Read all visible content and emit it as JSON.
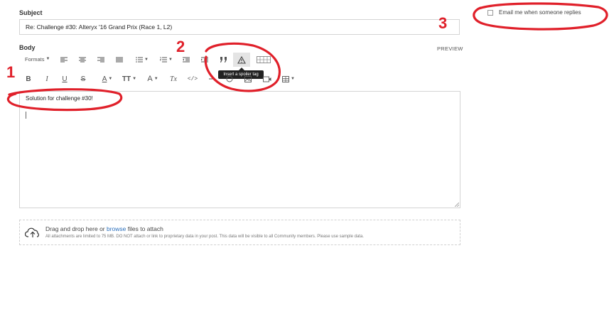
{
  "subject": {
    "label": "Subject",
    "value": "Re: Challenge #30: Alteryx '16 Grand Prix (Race 1, L2)"
  },
  "body": {
    "label": "Body",
    "preview": "PREVIEW"
  },
  "toolbar": {
    "formats_label": "Formats",
    "spoiler_tooltip": "Insert a spoiler tag",
    "row2": {
      "bold": "B",
      "italic": "I",
      "underline": "U",
      "strike": "S",
      "font_color": "A",
      "font_size": "TT",
      "font_family": "A",
      "clear": "Tx",
      "code": "</>"
    }
  },
  "editor": {
    "content": "Solution for challenge #30!"
  },
  "attach": {
    "prefix": "Drag and drop here or ",
    "link": "browse",
    "suffix": " files to attach",
    "note": "All attachments are limited to 75 MB. DO NOT attach or link to proprietary data in your post. This data will be visible to all Community members. Please use sample data."
  },
  "email_option": {
    "label": "Email me when someone replies",
    "checked": false
  },
  "annotations": {
    "one": "1",
    "two": "2",
    "three": "3"
  },
  "colors": {
    "annotation": "#e0202a",
    "link": "#2a6ebb"
  }
}
